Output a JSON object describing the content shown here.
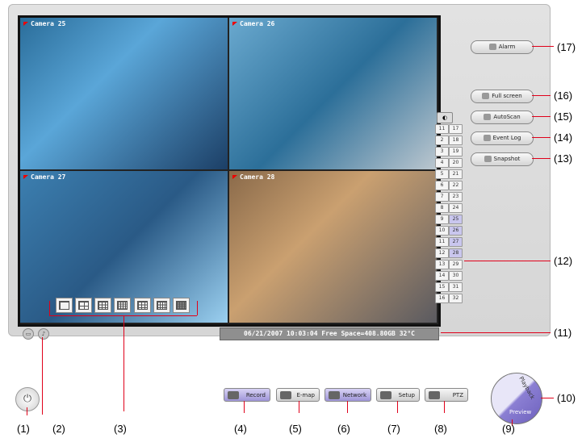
{
  "cameras": [
    {
      "label": "Camera 25"
    },
    {
      "label": "Camera 26"
    },
    {
      "label": "Camera 27"
    },
    {
      "label": "Camera 28"
    }
  ],
  "status_text": "06/21/2007 10:03:04 Free Space=408.80GB 32°C",
  "channels": {
    "left": [
      "11",
      "2",
      "3",
      "4",
      "5",
      "6",
      "7",
      "8",
      "9",
      "10",
      "11",
      "12",
      "13",
      "14",
      "15",
      "16"
    ],
    "right": [
      "17",
      "18",
      "19",
      "20",
      "21",
      "22",
      "23",
      "24",
      "25",
      "26",
      "27",
      "28",
      "29",
      "30",
      "31",
      "32"
    ]
  },
  "side_buttons": {
    "alarm": "Alarm",
    "full_screen": "Full screen",
    "autoscan": "AutoScan",
    "event_log": "Event Log",
    "snapshot": "Snapshot"
  },
  "bottom_buttons": {
    "record": "Record",
    "emap": "E-map",
    "network": "Network",
    "setup": "Setup",
    "ptz": "PTZ"
  },
  "mode_switch": {
    "playback": "Playback",
    "preview": "Preview"
  },
  "callouts": {
    "c1": "(1)",
    "c2": "(2)",
    "c3": "(3)",
    "c4": "(4)",
    "c5": "(5)",
    "c6": "(6)",
    "c7": "(7)",
    "c8": "(8)",
    "c9": "(9)",
    "c10": "(10)",
    "c11": "(11)",
    "c12": "(12)",
    "c13": "(13)",
    "c14": "(14)",
    "c15": "(15)",
    "c16": "(16)",
    "c17": "(17)"
  },
  "colors": {
    "accent": "#e0001a",
    "selected_channel": "#c9c6ee",
    "active_button": "#9e95d8"
  }
}
